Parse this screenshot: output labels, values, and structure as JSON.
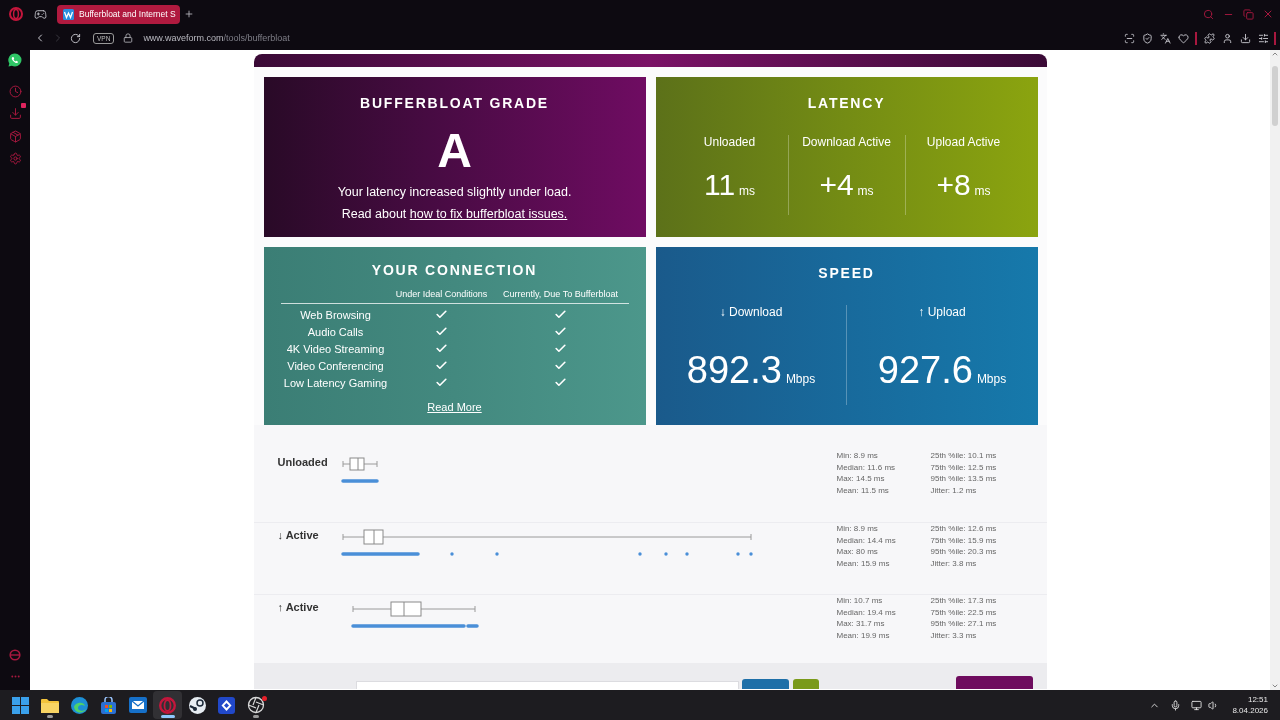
{
  "browser": {
    "tab_title": "Bufferbloat and Internet S",
    "vpn_badge": "VPN",
    "url_host": "www.waveform.com",
    "url_path": "/tools/bufferbloat"
  },
  "grade_card": {
    "title": "BUFFERBLOAT GRADE",
    "grade": "A",
    "summary": "Your latency increased slightly under load.",
    "fix_prefix": "Read about",
    "fix_link": "how to fix bufferbloat issues."
  },
  "latency_card": {
    "title": "LATENCY",
    "columns": [
      {
        "label": "Unloaded",
        "value": "11",
        "unit": "ms"
      },
      {
        "label": "Download Active",
        "value": "+4",
        "unit": "ms"
      },
      {
        "label": "Upload Active",
        "value": "+8",
        "unit": "ms"
      }
    ]
  },
  "connection_card": {
    "title": "YOUR CONNECTION",
    "columns": [
      "Under Ideal Conditions",
      "Currently, Due To Bufferbloat"
    ],
    "rows": [
      {
        "name": "Web Browsing",
        "ideal": true,
        "current": true
      },
      {
        "name": "Audio Calls",
        "ideal": true,
        "current": true
      },
      {
        "name": "4K Video Streaming",
        "ideal": true,
        "current": true
      },
      {
        "name": "Video Conferencing",
        "ideal": true,
        "current": true
      },
      {
        "name": "Low Latency Gaming",
        "ideal": true,
        "current": true
      }
    ],
    "link": "Read More"
  },
  "speed_card": {
    "title": "SPEED",
    "columns": [
      {
        "label": "↓ Download",
        "value": "892.3",
        "unit": "Mbps"
      },
      {
        "label": "↑ Upload",
        "value": "927.6",
        "unit": "Mbps"
      }
    ]
  },
  "latency_rows": [
    {
      "label": "Unloaded",
      "stats": [
        [
          "Min: 8.9 ms",
          "Median: 11.6 ms",
          "Max: 14.5 ms",
          "Mean: 11.5 ms"
        ],
        [
          "25th %ile: 10.1 ms",
          "75th %ile: 12.5 ms",
          "95th %ile: 13.5 ms",
          "Jitter: 1.2 ms"
        ]
      ]
    },
    {
      "label": "↓ Active",
      "stats": [
        [
          "Min: 8.9 ms",
          "Median: 14.4 ms",
          "Max: 80 ms",
          "Mean: 15.9 ms"
        ],
        [
          "25th %ile: 12.6 ms",
          "75th %ile: 15.9 ms",
          "95th %ile: 20.3 ms",
          "Jitter: 3.8 ms"
        ]
      ]
    },
    {
      "label": "↑ Active",
      "stats": [
        [
          "Min: 10.7 ms",
          "Median: 19.4 ms",
          "Max: 31.7 ms",
          "Mean: 19.9 ms"
        ],
        [
          "25th %ile: 17.3 ms",
          "75th %ile: 22.5 ms",
          "95th %ile: 27.1 ms",
          "Jitter: 3.3 ms"
        ]
      ]
    }
  ],
  "taskbar": {
    "apps": [
      {
        "kind": "start",
        "running": false,
        "focused": false
      },
      {
        "kind": "folder",
        "running": true,
        "focused": false
      },
      {
        "kind": "swirl",
        "running": false,
        "focused": false
      },
      {
        "kind": "bag",
        "running": false,
        "focused": false
      },
      {
        "kind": "mail",
        "running": false,
        "focused": false
      },
      {
        "kind": "ring",
        "running": true,
        "focused": true
      },
      {
        "kind": "disc",
        "running": false,
        "focused": false
      },
      {
        "kind": "diamond",
        "running": false,
        "focused": false
      },
      {
        "kind": "aperture",
        "running": true,
        "focused": false
      }
    ],
    "time": "12:51",
    "date": "8.04.2026"
  }
}
